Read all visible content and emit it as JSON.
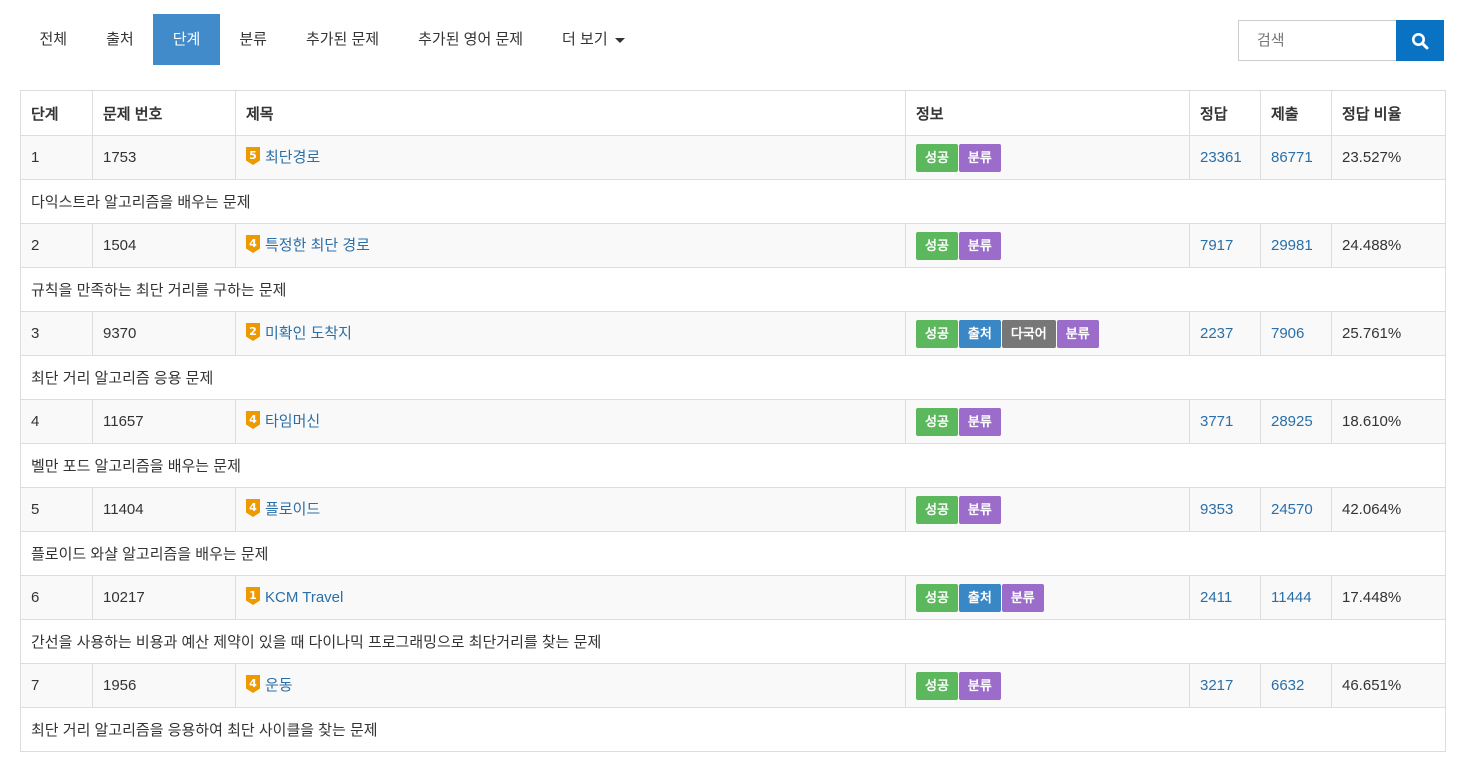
{
  "nav": {
    "tabs": [
      {
        "label": "전체",
        "active": false
      },
      {
        "label": "출처",
        "active": false
      },
      {
        "label": "단계",
        "active": true
      },
      {
        "label": "분류",
        "active": false
      },
      {
        "label": "추가된 문제",
        "active": false
      },
      {
        "label": "추가된 영어 문제",
        "active": false
      },
      {
        "label": "더 보기",
        "active": false
      }
    ],
    "search_placeholder": "검색"
  },
  "table": {
    "headers": {
      "step": "단계",
      "problem_id": "문제 번호",
      "title": "제목",
      "info": "정보",
      "correct": "정답",
      "submit": "제출",
      "ratio": "정답 비율"
    },
    "rows": [
      {
        "step": "1",
        "problem_id": "1753",
        "tier": "5",
        "title": "최단경로",
        "labels": [
          "성공",
          "분류"
        ],
        "correct": "23361",
        "submit": "86771",
        "ratio": "23.527%",
        "desc": "다익스트라 알고리즘을 배우는 문제"
      },
      {
        "step": "2",
        "problem_id": "1504",
        "tier": "4",
        "title": "특정한 최단 경로",
        "labels": [
          "성공",
          "분류"
        ],
        "correct": "7917",
        "submit": "29981",
        "ratio": "24.488%",
        "desc": "규칙을 만족하는 최단 거리를 구하는 문제"
      },
      {
        "step": "3",
        "problem_id": "9370",
        "tier": "2",
        "title": "미확인 도착지",
        "labels": [
          "성공",
          "출처",
          "다국어",
          "분류"
        ],
        "correct": "2237",
        "submit": "7906",
        "ratio": "25.761%",
        "desc": "최단 거리 알고리즘 응용 문제"
      },
      {
        "step": "4",
        "problem_id": "11657",
        "tier": "4",
        "title": "타임머신",
        "labels": [
          "성공",
          "분류"
        ],
        "correct": "3771",
        "submit": "28925",
        "ratio": "18.610%",
        "desc": "벨만 포드 알고리즘을 배우는 문제"
      },
      {
        "step": "5",
        "problem_id": "11404",
        "tier": "4",
        "title": "플로이드",
        "labels": [
          "성공",
          "분류"
        ],
        "correct": "9353",
        "submit": "24570",
        "ratio": "42.064%",
        "desc": "플로이드 와샬 알고리즘을 배우는 문제"
      },
      {
        "step": "6",
        "problem_id": "10217",
        "tier": "1",
        "title": "KCM Travel",
        "labels": [
          "성공",
          "출처",
          "분류"
        ],
        "correct": "2411",
        "submit": "11444",
        "ratio": "17.448%",
        "desc": "간선을 사용하는 비용과 예산 제약이 있을 때 다이나믹 프로그래밍으로 최단거리를 찾는 문제"
      },
      {
        "step": "7",
        "problem_id": "1956",
        "tier": "4",
        "title": "운동",
        "labels": [
          "성공",
          "분류"
        ],
        "correct": "3217",
        "submit": "6632",
        "ratio": "46.651%",
        "desc": "최단 거리 알고리즘을 응용하여 최단 사이클을 찾는 문제"
      }
    ]
  },
  "colors": {
    "active_tab": "#428bca",
    "search_button": "#0a72c2",
    "link": "#2a6fa8",
    "tier_gold": "#ec9a00",
    "label_success": "#5cb85c",
    "label_source": "#3a87c6",
    "label_lang": "#777777",
    "label_category": "#9b6cc9"
  },
  "icons": {
    "search": "search-icon",
    "tier": "gold-tier-icon",
    "dropdown": "caret-down-icon"
  }
}
